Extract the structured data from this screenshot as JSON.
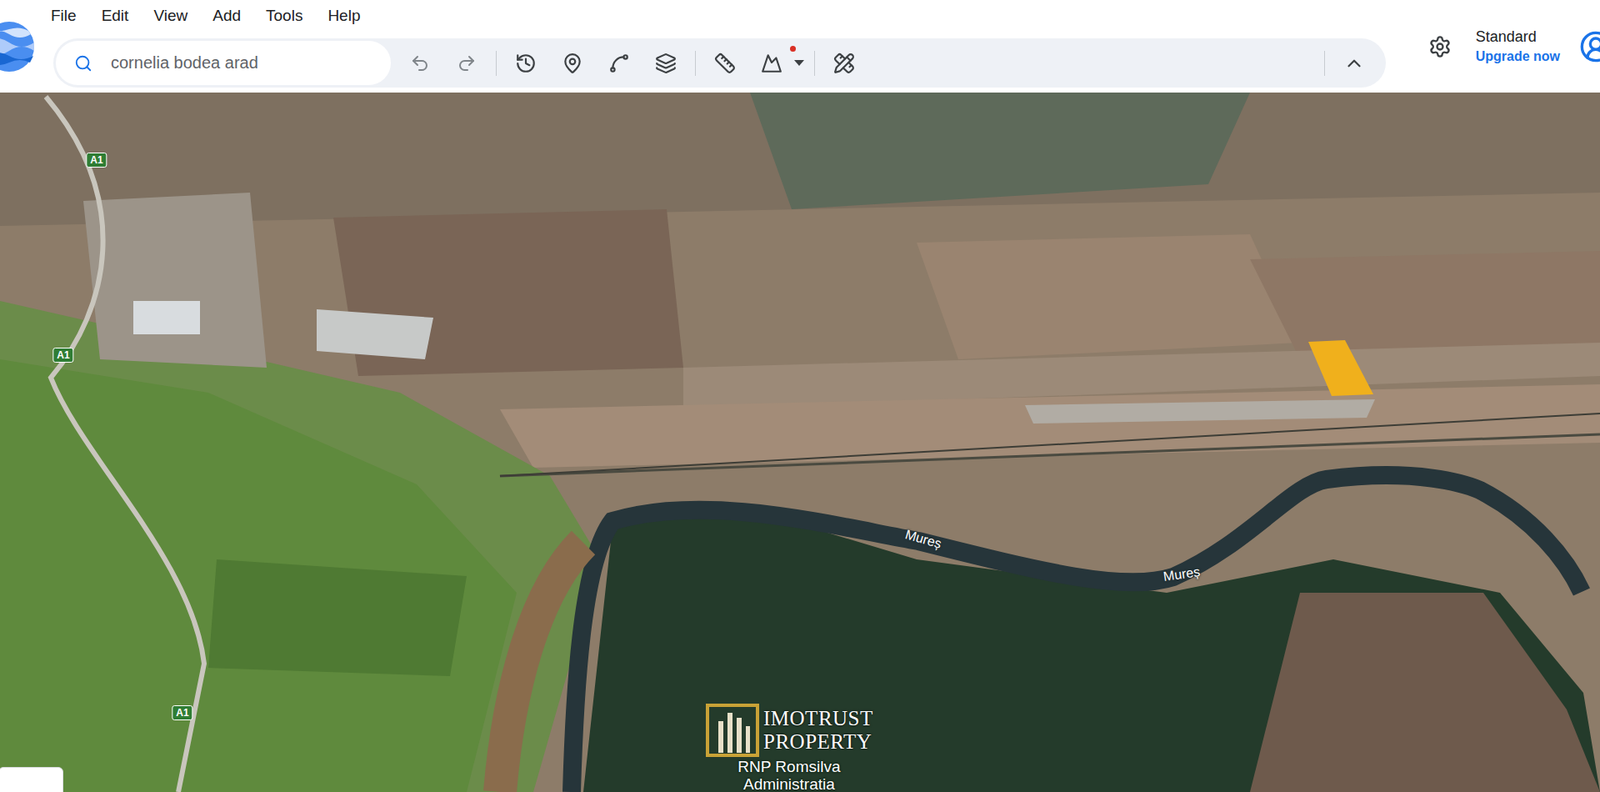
{
  "window": {
    "title": "Google Earth"
  },
  "menu": [
    "File",
    "Edit",
    "View",
    "Add",
    "Tools",
    "Help"
  ],
  "search": {
    "value": "cornelia bodea arad"
  },
  "toolbar": {
    "terrain_notification": true
  },
  "account": {
    "plan": "Standard",
    "upgrade": "Upgrade now"
  },
  "map": {
    "labels": [
      {
        "text": "A1",
        "kind": "shield"
      },
      {
        "text": "A1",
        "kind": "shield"
      },
      {
        "text": "A1",
        "kind": "shield"
      },
      {
        "text": "Mureș",
        "kind": "river"
      },
      {
        "text": "Mureș",
        "kind": "river"
      }
    ],
    "logo": {
      "name": "IMOTRUST",
      "tagline": "PROPERTY"
    },
    "places": [
      "RNP Romsilva",
      "Administratia"
    ],
    "highlight": {
      "color": "#f0b01c"
    }
  }
}
